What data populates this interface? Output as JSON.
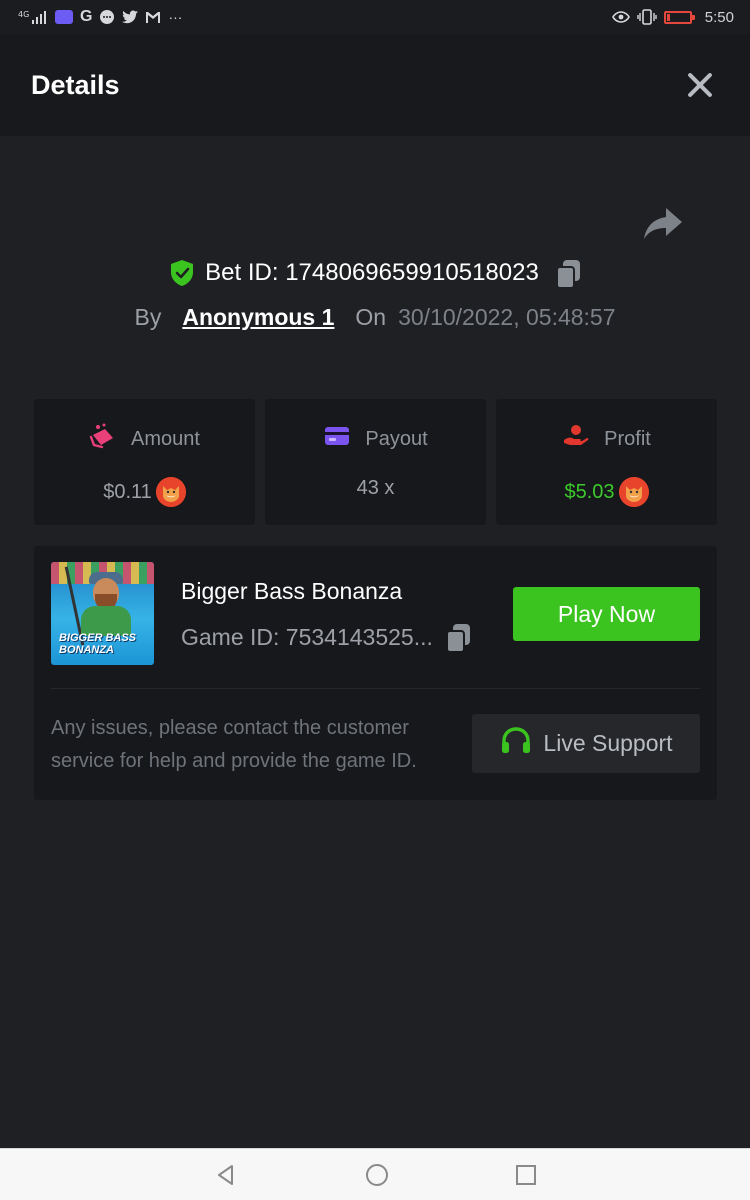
{
  "status_bar": {
    "network": "4G",
    "app_icons": [
      "messenger-icon",
      "g-icon",
      "chat-icon",
      "twitter-icon",
      "gmail-icon"
    ],
    "more": "···",
    "time": "5:50"
  },
  "header": {
    "title": "Details"
  },
  "bet": {
    "id_label": "Bet ID: 1748069659910518023",
    "by_label": "By",
    "user": "Anonymous 1",
    "on_label": "On",
    "date": "30/10/2022, 05:48:57"
  },
  "stats": {
    "amount": {
      "label": "Amount",
      "value": "$0.11",
      "color": "#e9407a"
    },
    "payout": {
      "label": "Payout",
      "value": "43 x",
      "color": "#7b54f0"
    },
    "profit": {
      "label": "Profit",
      "value": "$5.03",
      "color": "#e2372e"
    }
  },
  "game": {
    "name": "Bigger Bass Bonanza",
    "id_label": "Game ID: 7534143525...",
    "thumb_text": "BIGGER BASS BONANZA",
    "play_label": "Play Now",
    "support_text": "Any issues, please contact the customer service for help and provide the game ID.",
    "support_label": "Live Support"
  },
  "colors": {
    "accent_green": "#3bc41f",
    "background": "#1f2023",
    "card": "#17181b"
  }
}
